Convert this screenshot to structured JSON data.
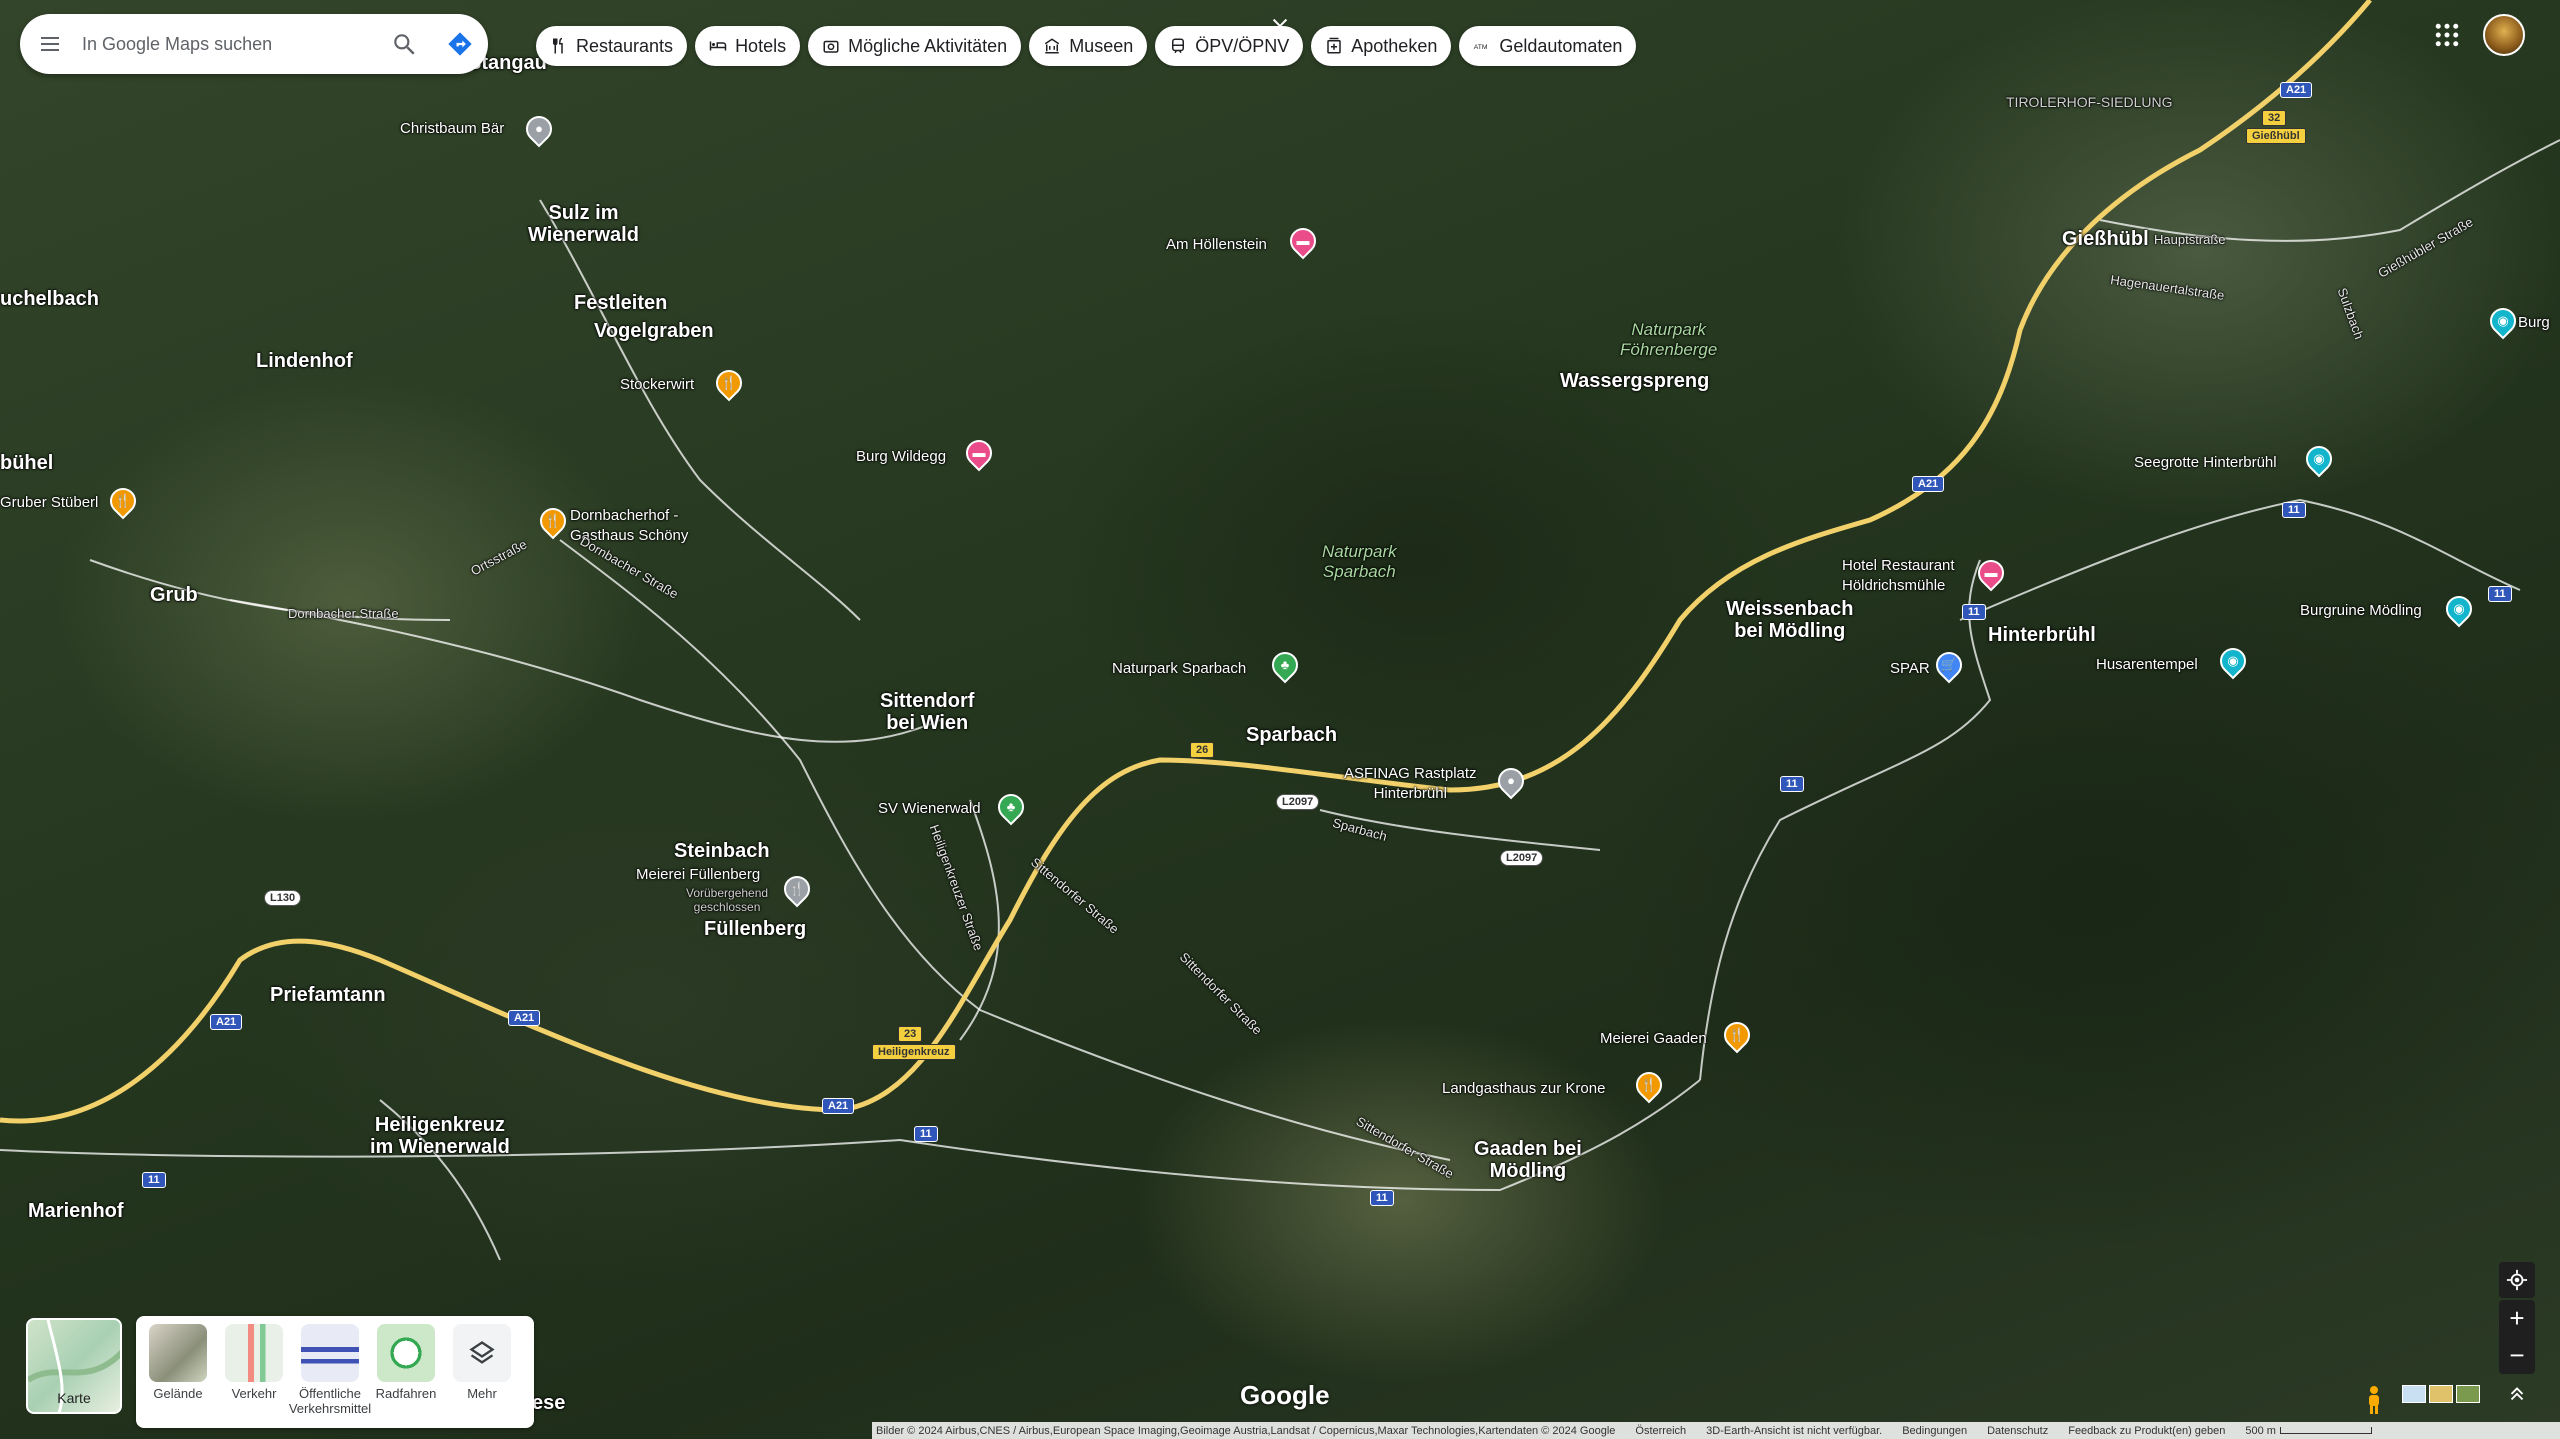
{
  "search": {
    "placeholder": "In Google Maps suchen"
  },
  "chips": [
    {
      "label": "Restaurants",
      "icon": "fork-knife-icon"
    },
    {
      "label": "Hotels",
      "icon": "bed-icon"
    },
    {
      "label": "Mögliche Aktivitäten",
      "icon": "camera-icon"
    },
    {
      "label": "Museen",
      "icon": "museum-icon"
    },
    {
      "label": "ÖPV/ÖPNV",
      "icon": "transit-icon"
    },
    {
      "label": "Apotheken",
      "icon": "pharmacy-icon"
    },
    {
      "label": "Geldautomaten",
      "icon": "atm-icon"
    }
  ],
  "places": {
    "stangau": "Stangau",
    "christbaum": "Christbaum Bär",
    "sulz": "Sulz im\nWienerwald",
    "festleiten": "Festleiten",
    "vogelgraben": "Vogelgraben",
    "stockerwirt": "Stockerwirt",
    "hoellenstein": "Am Höllenstein",
    "naturpark_foehrenberge": "Naturpark\nFöhrenberge",
    "wassergspreng": "Wassergspreng",
    "giesshuebl": "Gießhübl",
    "tirolerhof": "TIROLERHOF-SIEDLUNG",
    "burg_right": "Burg",
    "uchelbach": "uchelbach",
    "lindenhof": "Lindenhof",
    "buehel": "bühel",
    "gruber": "Gruber Stüberl",
    "burg_wildegg": "Burg Wildegg",
    "dornbacherhof": "Dornbacherhof -\nGasthaus Schöny",
    "grub": "Grub",
    "naturpark_sparbach": "Naturpark\nSparbach",
    "seegrotte": "Seegrotte Hinterbrühl",
    "hotel_hoeldrich": "Hotel Restaurant\nHöldrichsmühle",
    "weissenbach": "Weissenbach\nbei Mödling",
    "hinterbruehl": "Hinterbrühl",
    "burgruine": "Burgruine Mödling",
    "husarentempel": "Husarentempel",
    "spar": "SPAR",
    "naturpark_sparbach_poi": "Naturpark Sparbach",
    "sittendorf": "Sittendorf\nbei Wien",
    "sparbach": "Sparbach",
    "asfinag": "ASFINAG Rastplatz\nHinterbrühl",
    "sv_wienerwald": "SV Wienerwald",
    "steinbach": "Steinbach",
    "meierei_fuellenberg": "Meierei Füllenberg",
    "voruebergehend": "Vorübergehend\ngeschlossen",
    "fuellenberg": "Füllenberg",
    "priefamtann": "Priefamtann",
    "heiligenkreuz": "Heiligenkreuz\nim Wienerwald",
    "marienhof": "Marienhof",
    "meierei_gaaden": "Meierei Gaaden",
    "landgasthaus": "Landgasthaus zur Krone",
    "gaaden": "Gaaden bei\nMödling",
    "heiligenkreuz_sign": "Heiligenkreuz",
    "giesshuebl_sign": "Gießhübl",
    "ese": "ese"
  },
  "streets": {
    "dornbacher1": "Dornbacher Straße",
    "dornbacher2": "Dornbacher Straße",
    "ortsstrasse": "Ortsstraße",
    "sittendorfer1": "Sittendorfer Straße",
    "sittendorfer2": "Sittendorfer Straße",
    "sittendorfer3": "Sittendorfer Straße",
    "heiligenkreuzer": "Heiligenkreuzer Straße",
    "sparbach_str": "Sparbach",
    "hauptstrasse": "Hauptstraße",
    "giesshuebler": "Gießhübler Straße",
    "hagenauertal": "Hagenauertalstraße",
    "sulzbach": "Sulzbach"
  },
  "shields": {
    "a21_1": "A21",
    "a21_2": "A21",
    "a21_3": "A21",
    "a21_4": "A21",
    "a21_5": "A21",
    "r11_1": "11",
    "r11_2": "11",
    "r11_3": "11",
    "r11_4": "11",
    "r11_5": "11",
    "r11_6": "11",
    "r11_7": "11",
    "l2097_1": "L2097",
    "l2097_2": "L2097",
    "l130": "L130",
    "e26": "26",
    "e23": "23",
    "e32": "32"
  },
  "layers": {
    "karte": "Karte",
    "items": [
      {
        "label": "Gelände"
      },
      {
        "label": "Verkehr"
      },
      {
        "label": "Öffentliche\nVerkehrsmittel"
      },
      {
        "label": "Radfahren"
      },
      {
        "label": "Mehr"
      }
    ]
  },
  "google_logo": "Google",
  "footer": {
    "imagery": "Bilder © 2024 Airbus,CNES / Airbus,European Space Imaging,Geoimage Austria,Landsat / Copernicus,Maxar Technologies,Kartendaten © 2024 Google",
    "country": "Österreich",
    "notice": "3D-Earth-Ansicht ist nicht verfügbar.",
    "terms": "Bedingungen",
    "privacy": "Datenschutz",
    "feedback": "Feedback zu Produkt(en) geben",
    "scale": "500 m"
  },
  "colors": {
    "motorway": "#f2d16b",
    "road": "#ffffff",
    "shield_blue": "#2f56b8",
    "pin_food": "#f29900",
    "pin_hotel": "#ea4c89",
    "pin_attraction": "#12b5cb",
    "pin_park": "#34a853",
    "pin_shop": "#4285f4",
    "pin_gray": "#9aa0a6"
  }
}
